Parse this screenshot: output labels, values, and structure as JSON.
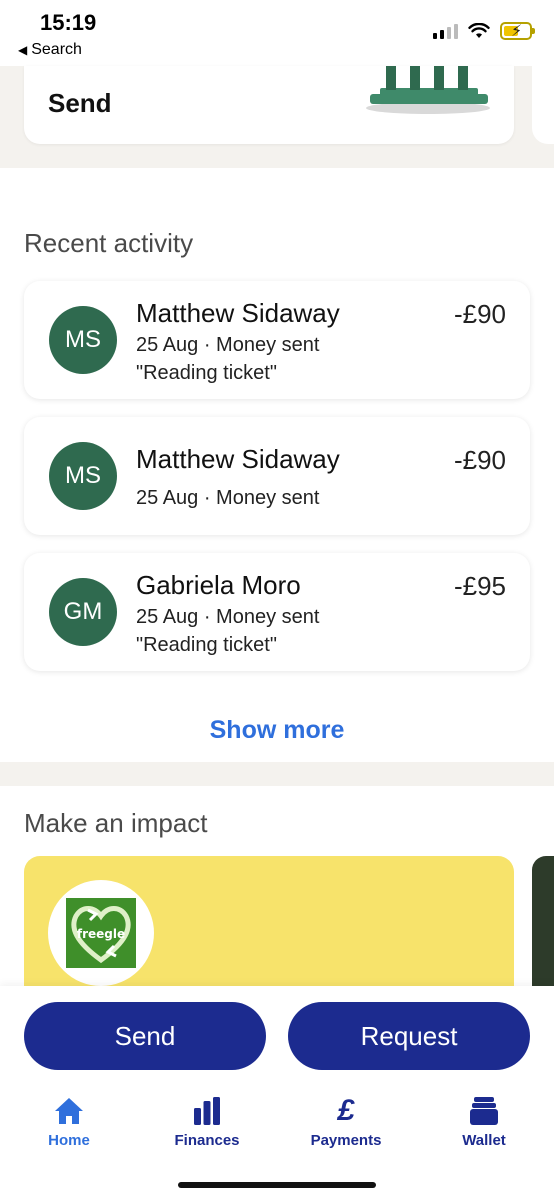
{
  "status_bar": {
    "time": "15:19",
    "back_label": "Search"
  },
  "send_card": {
    "title": "Send"
  },
  "recent_activity": {
    "title": "Recent activity",
    "items": [
      {
        "initials": "MS",
        "name": "Matthew Sidaway",
        "date_type": "25 Aug · Money sent",
        "note": "\"Reading ticket\"",
        "amount": "-£90"
      },
      {
        "initials": "MS",
        "name": "Matthew Sidaway",
        "date_type": "25 Aug · Money sent",
        "note": "",
        "amount": "-£90"
      },
      {
        "initials": "GM",
        "name": "Gabriela Moro",
        "date_type": "25 Aug · Money sent",
        "note": "\"Reading ticket\"",
        "amount": "-£95"
      }
    ],
    "show_more": "Show more"
  },
  "impact": {
    "title": "Make an impact",
    "logo_text": "freegle"
  },
  "actions": {
    "send": "Send",
    "request": "Request"
  },
  "nav": {
    "items": [
      {
        "label": "Home",
        "icon": "home-icon",
        "active": true
      },
      {
        "label": "Finances",
        "icon": "bar-chart-icon",
        "active": false
      },
      {
        "label": "Payments",
        "icon": "pound-icon",
        "active": false
      },
      {
        "label": "Wallet",
        "icon": "wallet-icon",
        "active": false
      }
    ]
  },
  "colors": {
    "brand_navy": "#1c2b8f",
    "link_blue": "#2f6fdc",
    "avatar_green": "#2f6a4f",
    "impact_yellow": "#f7e36b"
  }
}
